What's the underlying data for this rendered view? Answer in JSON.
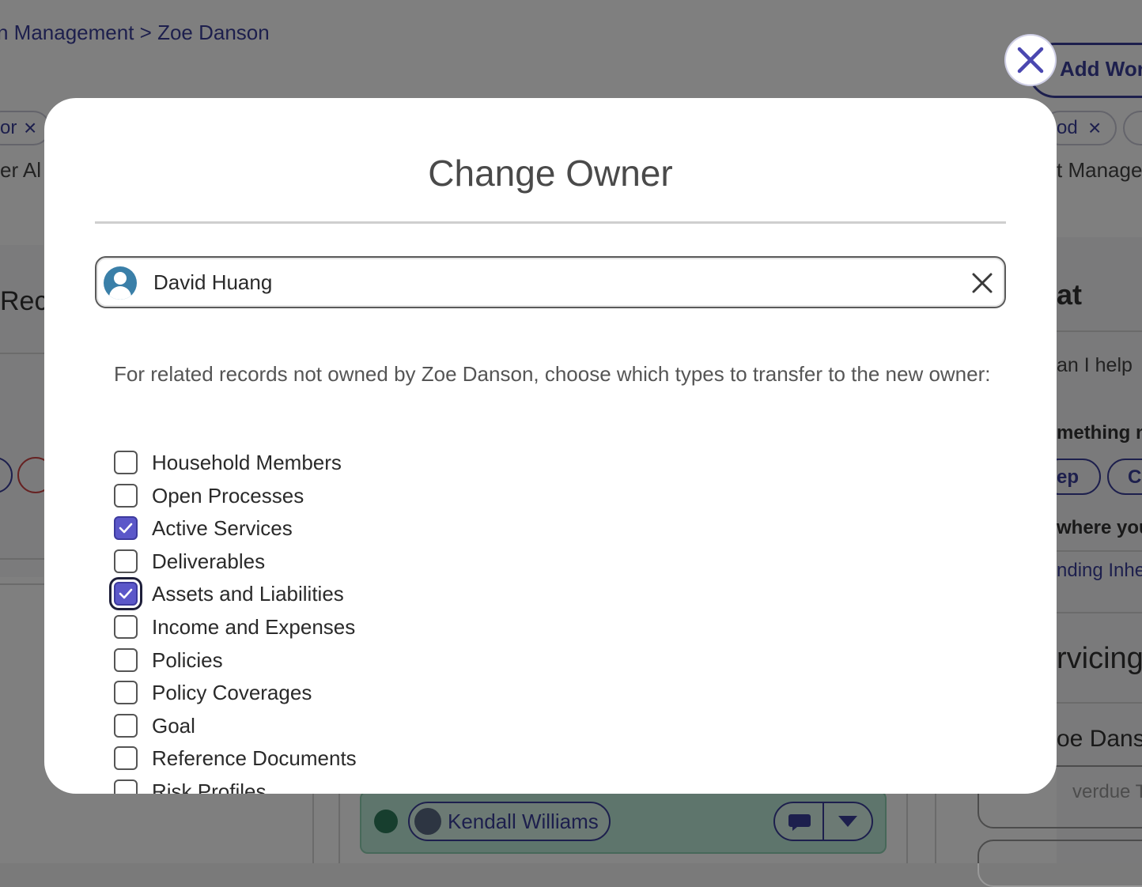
{
  "background": {
    "breadcrumb": "n Management > Zoe Danson",
    "add_work_label": "Add Wor",
    "chip_left_text": "or",
    "chip_right_text": "od",
    "left_label": "er Al",
    "right_label": "t Manage",
    "left_heading": "Reco",
    "right_heading": "at",
    "right_prompt": "an I help",
    "right_bold": "mething n",
    "right_chip_1": "ep",
    "right_chip_2": "C",
    "right_where": "where you",
    "right_link": "nding Inhe",
    "right_section": "rvicing",
    "right_person": "oe Dans",
    "right_overdue": "verdue Tas",
    "assignee_name": "Kendall Williams"
  },
  "modal": {
    "title": "Change Owner",
    "owner_value": "David Huang",
    "instruction": "For related records not owned by Zoe Danson, choose which types to transfer to the new owner:",
    "options": [
      {
        "label": "Household Members",
        "checked": false
      },
      {
        "label": "Open Processes",
        "checked": false
      },
      {
        "label": "Active Services",
        "checked": true
      },
      {
        "label": "Deliverables",
        "checked": false
      },
      {
        "label": "Assets and Liabilities",
        "checked": true,
        "focused": true
      },
      {
        "label": "Income and Expenses",
        "checked": false
      },
      {
        "label": "Policies",
        "checked": false
      },
      {
        "label": "Policy Coverages",
        "checked": false
      },
      {
        "label": "Goal",
        "checked": false
      },
      {
        "label": "Reference Documents",
        "checked": false
      },
      {
        "label": "Risk Profiles",
        "checked": false
      }
    ]
  },
  "icons": {
    "close": "close-icon",
    "clear": "clear-icon",
    "avatar": "user-avatar-icon",
    "check": "checkmark-icon"
  },
  "colors": {
    "accent": "#5b57c9",
    "brand": "#3a3f9a",
    "owner_avatar": "#3a7fa8"
  }
}
